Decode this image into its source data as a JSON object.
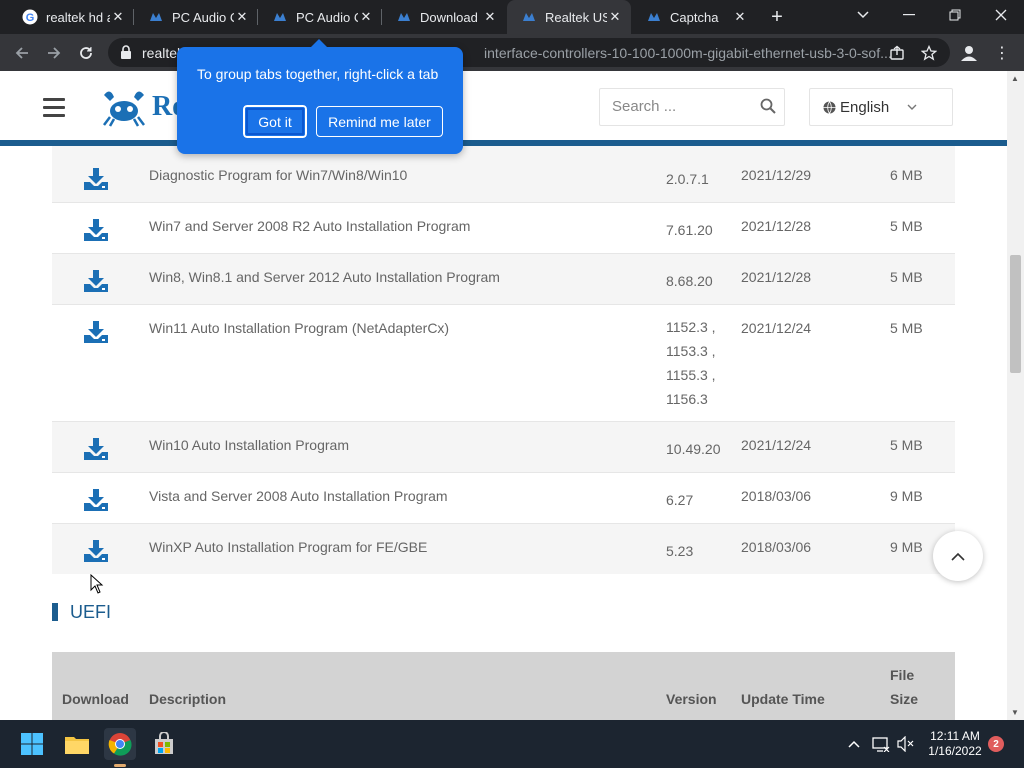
{
  "tabs": [
    {
      "title": "realtek hd a",
      "icon": "google-icon"
    },
    {
      "title": "PC Audio C",
      "icon": "realtek-crab-icon"
    },
    {
      "title": "PC Audio C",
      "icon": "realtek-crab-icon"
    },
    {
      "title": "Download",
      "icon": "realtek-crab-icon"
    },
    {
      "title": "Realtek USB",
      "icon": "realtek-crab-icon",
      "active": true
    },
    {
      "title": "Captcha",
      "icon": "realtek-crab-icon"
    }
  ],
  "omnibox": {
    "url_host": "realtek",
    "url_rest": "interface-controllers-10-100-1000m-gigabit-ethernet-usb-3-0-sof..."
  },
  "site": {
    "logo_text": "Re",
    "search_placeholder": "Search ...",
    "language": "English"
  },
  "popover": {
    "message": "To group tabs together, right-click a tab",
    "got_it": "Got it",
    "remind_later": "Remind me later"
  },
  "downloads": [
    {
      "description": "Diagnostic Program for Win7/Win8/Win10",
      "version": "2.0.7.1",
      "date": "2021/12/29",
      "size": "6 MB"
    },
    {
      "description": "Win7 and Server 2008 R2 Auto Installation Program",
      "version": "7.61.20",
      "date": "2021/12/28",
      "size": "5 MB"
    },
    {
      "description": "Win8, Win8.1 and Server 2012 Auto Installation Program",
      "version": "8.68.20",
      "date": "2021/12/28",
      "size": "5 MB"
    },
    {
      "description": "Win11 Auto Installation Program (NetAdapterCx)",
      "version": "1152.3 ,\n1153.3 ,\n1155.3 ,\n1156.3",
      "date": "2021/12/24",
      "size": "5 MB"
    },
    {
      "description": "Win10 Auto Installation Program",
      "version": "10.49.20",
      "date": "2021/12/24",
      "size": "5 MB"
    },
    {
      "description": "Vista and Server 2008 Auto Installation Program",
      "version": "6.27",
      "date": "2018/03/06",
      "size": "9 MB"
    },
    {
      "description": "WinXP Auto Installation Program for FE/GBE",
      "version": "5.23",
      "date": "2018/03/06",
      "size": "9 MB"
    }
  ],
  "uefi": {
    "heading": "UEFI",
    "columns": {
      "download": "Download",
      "description": "Description",
      "version": "Version",
      "update_time": "Update Time",
      "file_size_1": "File",
      "file_size_2": "Size"
    }
  },
  "taskbar": {
    "time": "12:11 AM",
    "date": "1/16/2022",
    "notifications": "2"
  },
  "colors": {
    "accent": "#1b5c8e",
    "popover": "#1a73e8",
    "download_icon": "#1b6fb5"
  }
}
